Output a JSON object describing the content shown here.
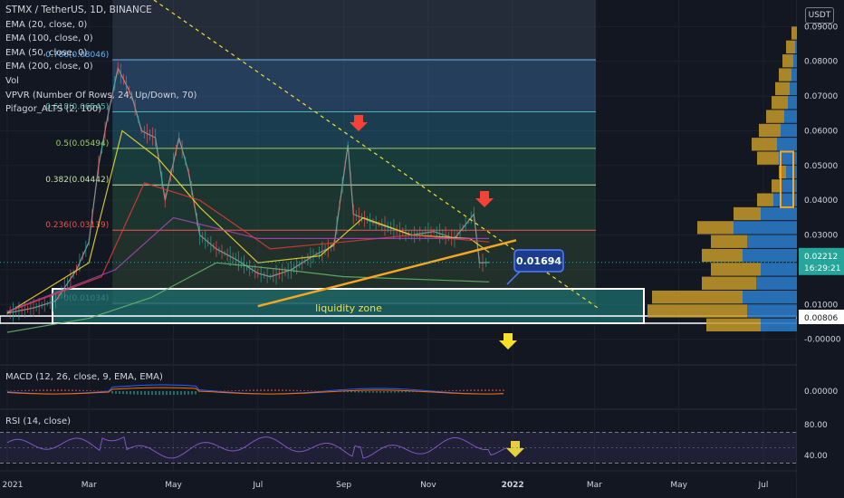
{
  "legend": {
    "title": "STMX / TetherUS, 1D, BINANCE",
    "lines": [
      "EMA (20, close, 0)",
      "EMA (100, close, 0)",
      "EMA (50, close, 0)",
      "EMA (200, close, 0)",
      "Vol",
      "VPVR (Number Of Rows, 24, Up/Down, 70)",
      "Pifagor_ALTS (2, 100)"
    ]
  },
  "currency_label": "USDT",
  "macd_label": "MACD (12, 26, close, 9, EMA, EMA)",
  "rsi_label": "RSI (14, close)",
  "colors": {
    "background": "#131722",
    "up": "#26a69a",
    "down": "#ef5350",
    "trendline": "#f5a623",
    "fib_top": "#3b6ea5",
    "liquidity": "#1e6b6b",
    "volume_up": "#2a78c2",
    "volume_down": "#c59a2a",
    "arrow_red": "#f44336",
    "arrow_yellow": "#f5e02a"
  },
  "chart_data": [
    {
      "type": "candlestick",
      "title": "STMX / TetherUS, 1D, BINANCE",
      "x_ticks": [
        "2021",
        "Mar",
        "May",
        "Jul",
        "Sep",
        "Nov",
        "2022",
        "Mar",
        "May",
        "Jul"
      ],
      "y_ticks": [
        "0.09000",
        "0.08000",
        "0.07000",
        "0.06000",
        "0.05000",
        "0.04000",
        "0.03000",
        "0.02000",
        "0.01000",
        "-0.00000"
      ],
      "ylim": [
        -0.004,
        0.094
      ],
      "price_path": [
        [
          "2021-01-01",
          0.0075
        ],
        [
          "2021-01-20",
          0.009
        ],
        [
          "2021-02-05",
          0.011
        ],
        [
          "2021-02-20",
          0.02
        ],
        [
          "2021-03-01",
          0.028
        ],
        [
          "2021-03-08",
          0.05
        ],
        [
          "2021-03-15",
          0.065
        ],
        [
          "2021-03-22",
          0.078
        ],
        [
          "2021-04-01",
          0.07
        ],
        [
          "2021-04-08",
          0.06
        ],
        [
          "2021-04-18",
          0.058
        ],
        [
          "2021-04-25",
          0.04
        ],
        [
          "2021-05-05",
          0.058
        ],
        [
          "2021-05-12",
          0.048
        ],
        [
          "2021-05-20",
          0.03
        ],
        [
          "2021-06-01",
          0.026
        ],
        [
          "2021-06-15",
          0.023
        ],
        [
          "2021-07-01",
          0.019
        ],
        [
          "2021-07-10",
          0.018
        ],
        [
          "2021-07-25",
          0.02
        ],
        [
          "2021-08-10",
          0.024
        ],
        [
          "2021-08-25",
          0.027
        ],
        [
          "2021-09-04",
          0.056
        ],
        [
          "2021-09-08",
          0.036
        ],
        [
          "2021-09-20",
          0.034
        ],
        [
          "2021-10-05",
          0.032
        ],
        [
          "2021-10-20",
          0.03
        ],
        [
          "2021-11-05",
          0.031
        ],
        [
          "2021-11-20",
          0.029
        ],
        [
          "2021-12-04",
          0.036
        ],
        [
          "2021-12-08",
          0.022
        ],
        [
          "2021-12-15",
          0.02212
        ]
      ],
      "ema": [
        {
          "name": "EMA (20, close, 0)",
          "color": "#f5e02a",
          "values": [
            [
              "2021-01-01",
              0.0075
            ],
            [
              "2021-03-01",
              0.022
            ],
            [
              "2021-03-25",
              0.06
            ],
            [
              "2021-04-20",
              0.052
            ],
            [
              "2021-05-20",
              0.038
            ],
            [
              "2021-07-01",
              0.022
            ],
            [
              "2021-08-15",
              0.024
            ],
            [
              "2021-09-15",
              0.035
            ],
            [
              "2021-10-20",
              0.03
            ],
            [
              "2021-12-01",
              0.029
            ],
            [
              "2021-12-15",
              0.025
            ]
          ]
        },
        {
          "name": "EMA (50, close, 0)",
          "color": "#e53935",
          "values": [
            [
              "2021-01-01",
              0.0078
            ],
            [
              "2021-03-10",
              0.018
            ],
            [
              "2021-04-10",
              0.045
            ],
            [
              "2021-05-20",
              0.04
            ],
            [
              "2021-07-10",
              0.026
            ],
            [
              "2021-09-01",
              0.028
            ],
            [
              "2021-10-20",
              0.03
            ],
            [
              "2021-12-15",
              0.028
            ]
          ]
        },
        {
          "name": "EMA (100, close, 0)",
          "color": "#ab47bc",
          "values": [
            [
              "2021-01-01",
              0.008
            ],
            [
              "2021-03-20",
              0.02
            ],
            [
              "2021-05-01",
              0.035
            ],
            [
              "2021-07-01",
              0.029
            ],
            [
              "2021-09-01",
              0.029
            ],
            [
              "2021-12-15",
              0.029
            ]
          ]
        },
        {
          "name": "EMA (200, close, 0)",
          "color": "#66bb6a",
          "values": [
            [
              "2021-01-01",
              0.002
            ],
            [
              "2021-03-01",
              0.006
            ],
            [
              "2021-04-15",
              0.012
            ],
            [
              "2021-06-01",
              0.022
            ],
            [
              "2021-07-20",
              0.02
            ],
            [
              "2021-09-01",
              0.018
            ],
            [
              "2021-12-15",
              0.0165
            ]
          ]
        }
      ],
      "fib_levels": [
        {
          "label": "0.786(0.08046)",
          "value": 0.08046
        },
        {
          "label": "0.618(0.06545)",
          "value": 0.06545
        },
        {
          "label": "0.5(0.05494)",
          "value": 0.05494
        },
        {
          "label": "0.382(0.04442)",
          "value": 0.04442
        },
        {
          "label": "0.236(0.03139)",
          "value": 0.03139
        },
        {
          "label": "0(0.01034)",
          "value": 0.01034
        }
      ],
      "annotations": {
        "liquidity_zone": "liquidity zone",
        "callout_price": "0.01694",
        "last_price": "0.02212",
        "countdown": "16:29:21",
        "crosshair_price": "0.00806"
      }
    },
    {
      "type": "line",
      "title": "MACD (12, 26, close, 9, EMA, EMA)",
      "y_ticks": [
        "0.00000"
      ]
    },
    {
      "type": "line",
      "title": "RSI (14, close)",
      "y_ticks": [
        "80.00",
        "40.00"
      ],
      "ylim": [
        20,
        100
      ]
    }
  ]
}
